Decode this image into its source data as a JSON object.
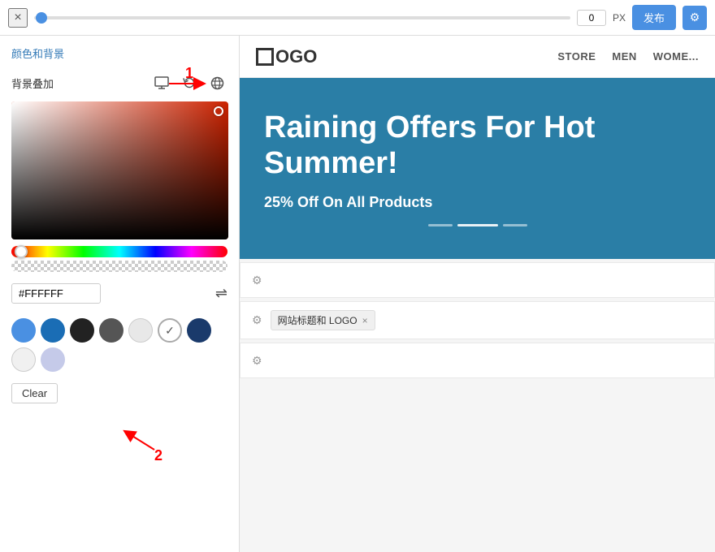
{
  "topbar": {
    "close_label": "×",
    "slider_value": "0",
    "slider_unit": "PX",
    "publish_label": "发布",
    "settings_icon": "⚙"
  },
  "left_panel": {
    "section_title": "颜色和背景",
    "bg_overlay_label": "背景叠加",
    "hex_value": "#FFFFFF",
    "annotation_1": "1",
    "annotation_2": "2",
    "clear_label": "Clear",
    "preset_colors": [
      {
        "color": "#4a90e2",
        "selected": false
      },
      {
        "color": "#1a6db5",
        "selected": false
      },
      {
        "color": "#222222",
        "selected": false
      },
      {
        "color": "#555555",
        "selected": false
      },
      {
        "color": "#eeeeee",
        "selected": false
      },
      {
        "color": "#ffffff",
        "selected": true,
        "border": "#aaa"
      },
      {
        "color": "#1a3a6b",
        "selected": false
      },
      {
        "color": "#f0f0f0",
        "selected": false
      },
      {
        "color": "#c5cae9",
        "selected": false
      }
    ]
  },
  "preview": {
    "logo_text": "OGO",
    "nav_links": [
      "STORE",
      "MEN",
      "WOME..."
    ],
    "hero_title": "Raining Offers For Hot Summer!",
    "hero_subtitle": "25% Off On All Products",
    "sections": [
      {
        "label": "",
        "has_tag": false
      },
      {
        "label": "网站标题和 LOGO",
        "has_tag": true
      },
      {
        "label": "",
        "has_tag": false
      }
    ]
  }
}
